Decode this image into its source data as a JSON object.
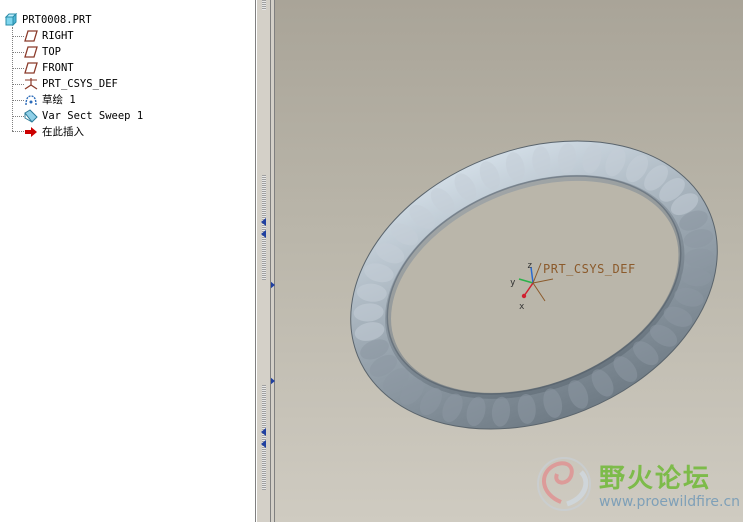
{
  "model_tree": {
    "root": "PRT0008.PRT",
    "items": [
      {
        "label": "RIGHT",
        "icon": "datum-plane-icon"
      },
      {
        "label": "TOP",
        "icon": "datum-plane-icon"
      },
      {
        "label": "FRONT",
        "icon": "datum-plane-icon"
      },
      {
        "label": "PRT_CSYS_DEF",
        "icon": "coordinate-system-icon"
      },
      {
        "label": "草绘 1",
        "icon": "sketch-icon"
      },
      {
        "label": "Var Sect Sweep 1",
        "icon": "sweep-feature-icon"
      },
      {
        "label": "在此插入",
        "icon": "insert-here-arrow-icon"
      }
    ]
  },
  "viewport": {
    "csys_label": "PRT_CSYS_DEF",
    "axis_labels": {
      "x": "x",
      "y": "y",
      "z": "z"
    }
  },
  "watermark": {
    "title": "野火论坛",
    "url": "www.proewildfire.cn"
  },
  "colors": {
    "tree_bg": "#ffffff",
    "plane_icon": "#8b3a2a",
    "insert_arrow": "#cc0000",
    "torus": "#aab4bd",
    "csys_label": "#8b5a2b",
    "watermark_green": "#7dbb4a"
  }
}
